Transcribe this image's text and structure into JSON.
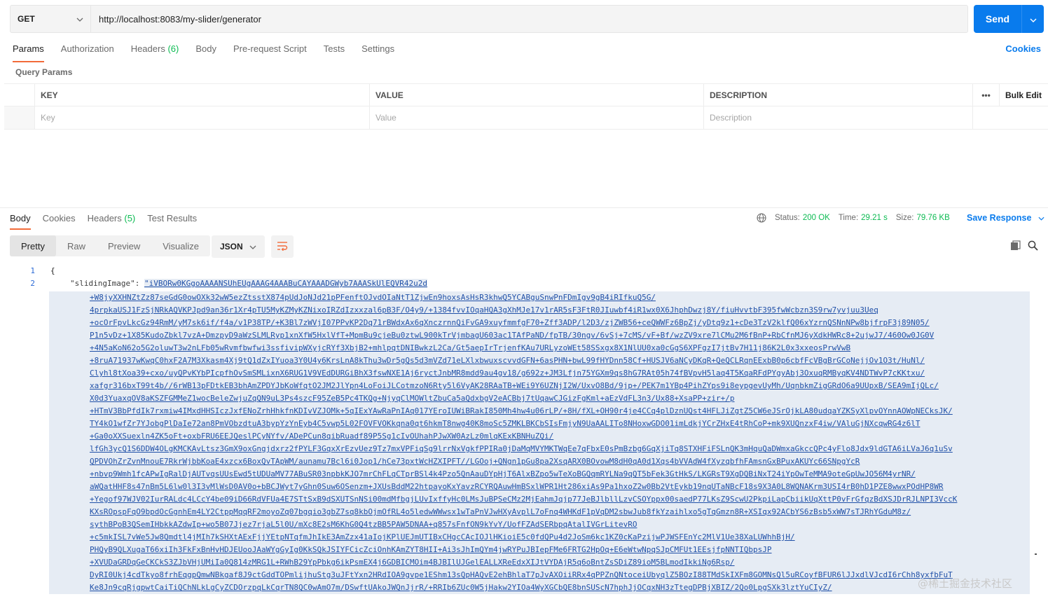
{
  "request": {
    "method": "GET",
    "url": "http://localhost:8083/my-slider/generator",
    "send_label": "Send"
  },
  "request_tabs": [
    {
      "label": "Params",
      "count": ""
    },
    {
      "label": "Authorization",
      "count": ""
    },
    {
      "label": "Headers",
      "count": "(6)"
    },
    {
      "label": "Body",
      "count": ""
    },
    {
      "label": "Pre-request Script",
      "count": ""
    },
    {
      "label": "Tests",
      "count": ""
    },
    {
      "label": "Settings",
      "count": ""
    }
  ],
  "cookies_link": "Cookies",
  "query_params": {
    "title": "Query Params",
    "headers": {
      "key": "KEY",
      "value": "VALUE",
      "description": "DESCRIPTION",
      "more": "•••",
      "bulk_edit": "Bulk Edit"
    },
    "placeholders": {
      "key": "Key",
      "value": "Value",
      "description": "Description"
    }
  },
  "response_tabs": [
    {
      "label": "Body",
      "count": ""
    },
    {
      "label": "Cookies",
      "count": ""
    },
    {
      "label": "Headers",
      "count": "(5)"
    },
    {
      "label": "Test Results",
      "count": ""
    }
  ],
  "status": {
    "status_label": "Status:",
    "status_value": "200 OK",
    "time_label": "Time:",
    "time_value": "29.21 s",
    "size_label": "Size:",
    "size_value": "79.76 KB",
    "save_response": "Save Response"
  },
  "view_modes": [
    "Pretty",
    "Raw",
    "Preview",
    "Visualize"
  ],
  "format": "JSON",
  "code": {
    "line_numbers": [
      "1",
      "2"
    ],
    "open_brace": "{",
    "key": "\"slidingImage\":",
    "value_start": "\"iVBORw0KGgoAAAANSUhEUgAAAG4AAABuCAYAAADGWyb7AAASkUlEQVR42u2d",
    "value_lines": [
      "+W8jyXXHNZtZz87seGdG0owOXk32wW5ezZtsstX874pUdJoNJd21pPFenftOJvdOIaNtT1ZjwEn9hoxsAsHsR3khwQ5YCABguSnwPnFDmIgv9gB4iRIfkuQ5G/",
      "4prpkaUSJ1FzSjNRkAQVKPJpd9an36r1Xr4pTU5MyKZMyKZNixoIRZdIzxxzal6pB3F/O4y9/+1384fvvIOqaHQA3gXhMJe17v1rAR5sF3FtR0JIuwbf4iR1wx0X6JhphDwzj8Y/fiuHvvtbF395fwWcbzn3S9rw7yvjuu3Ueq",
      "+ocOrFpvLkcGz94RmM/yM7sk6if/f4a/v1P38TP/+K3Bl7zWVjI07PPvKP2Dq71rBWdxAx6qXnczrnnQiFvGA9xuyfmmfgF70+Zff3ADP/l2D3/zjZWB56+ceQWWFz6BpZj/yDtq9z1+cDe3TzV2klfQ06xYzrnQSNnNPw8bjfrpF3j89N05/",
      "P1n5vDz+1X85KudoZbkl7vzA+DmzpyD9aWzSLMLRyp1xnXfW5HxlVfT+MpmBu9cjeBu0ztwL900kTrVjmbagU603ac1TAfPaND/fpTB/30ngv/6vSj+7cMS/vF+Bf/wzZV9xre7lCMu2M6fBnP+RbCfnMJ6yXdkHWRc8+2ujwJ7/460Ow0JG0V",
      "+4N5aKoN62o5G2oluwT3w2nLFb05wRvmfbwfwi3ssfivipWXyjcRYf3XbjB2+mhlpqtDNIBwkzL2Ca/Gt5aepIrTrjenfKAu7URLyzoWEt58SSxgx8X1NlUU0xa0cGgS6XPFgzI7jtBv7H11j86K2L0x3xxeosPrwVwB",
      "+8ruA71937wKwqC0hxF2A7M3Xkasm4Xj9tQ1dZxIYuoa3Y0U4y6KrsLnA8kThu3wDr5gQs5d3mVZd71eLXlxbwuxscvvdGFN+6asPHN+bwL99fHYDnn58Cf+HUSJV6aNCyDKqR+QeQCLRqnEExbB0p6cbfFcVBgBrGCoNejjOv1O3t/HuNl/",
      "Clyhl8tXoa39+cxo/uyQPvKYbPIcpfhOvSmSMLixnX6RUG1V9VEdDURGiBhX3fswNXE1Aj6ryctJnbMR8mdd9au4gv18/g692z+JM3Lfjn75YGXm9qs8hG7RAt05h74fBVpvH5laq4T5KqaRFdPYgyAbj3OxuqRMByqKV4NDTWvP7cKKtxu/",
      "xafgr316bxT99t4b//6rWB13pFDtkEB3bhAmZPDYJbKoWfqtO2JM2JlYpn4LoFoiJLCotmzoN6Rty5l6VyAK28RAaTB+WEi9Y6UZNjI2W/UxvO8Bd/9jp+/PEK7m1YBp4PihZYps9i8eypgevUyMh/UqnbkmZigGRdO6a9UUpxB/SEA9mIjQLc/",
      "X0d3YuaxqOV8aKSZFGMMeZ1wocBeleZwjuZqQN9uL3Ps4szcF95ZeB5Pc4TKQg+NjyqClMOWltZbuCa5aQdxbgV2eACBbj7tUqawCJGizFgKml+aEzVdFL3n3/Ux88+XsaPP+zir+/p",
      "+HTmV3BbPfdIk7rxmiw4IMxdHHSIczJxfENoZrhHhkfnKDIvVZJOMk+5qIExYAwRaPnIAq017YEroIUWiBRakI850Mh4hw4u06rLP/+8H/fXL+OH90r4je4CCq4plDznUQst4HFLJiZgtZ5CW6eJSrOjkLA80udqaYZKSyXlpvOYnnAOWpNECksJK/",
      "TY4kO1wfZr7YJobgPlDaIe72an8PmVObzdtuA3bypYzYnEyb4C5vwp5L02FOVFVOKkqna0qt6hkmT8nwg40K8moSc5ZMKLBKCbSIsFmjyN9UaAALITo8NHoxwGDO01imLdkjYCrZHxE4tRhCoP+mk9XUQnzxF4iw/VAluGjNXcqwRG4z6lT",
      "+Ga0oXXSuexln4ZK5oFt+oxbFRU6EEJQeslPCyNYfv/ADePCun8qibRuadf89P5Sg1cIvOUhahPJwXW0AzLz0mlqKExKBNHuZQi/",
      "lfGh3ycQ1S6DDW4OLgKMCKAvLtsz3GmX9oxGngjdxrz2fPYLF3GqxXrEzvUez9Tz7mxVPFiqSg9lrrNxVgkfPPIRa0jDaMqMVYMKTWqEe7qFbxE0sPmBzbg6GqXjiTq8STXHFiFSLnQK3mHquQaDWmxaGkccQPc4yFlo8Jdx9ldGTA6iLVaJ6q1uSv",
      "QPDVOhZrZvnMnouE7RkrWjbbKoaE4xzcx6BoxQvTApWM/aunamu7Bcl6i0Jop1/hCe73pxtWcHZXIPFT//LGOoj+QNgn1pGu8pa2XsqARX0BOvowM8dH0qA0d1Xqs4bVVAdW4fXyzqbfhFAmsnGxBPuxAKUYc66SNpgYcR",
      "+nbvp9Wmh1fcAPwIgRalDjAUTvqsUUsEwd5tUDUaMV77ABuSR03npbkKJO7mrChFLqCTprBSl4k4Pzo5QnAauDYpHjT6AlxBZpo5wTeXoBGQqmRYLNa9qQT5bFek3GtHkS/LKGRsT9XgDQBiNxT24iYpOwTeMMA9oteGpUwJO56M4yrNR/",
      "aWQatHHF8s47nBm5L6lw0l3I3vMlWsD0AV0o+bBCJWyt7yGhn0Suw6OSenzm+JXUsBddM22htpayoKxYavzRCYRQAuwHmBSxlWPR1Ht286xiAs9Pa1hxoZ2w0Bb2VtEykb19nqUTaNBcF18s9X3A0L8WQNAKrm3USI4rB0hD1PZE8wwxPOdHP8WR",
      "+Yegof97WJV02IurRALdc4LCcY4be09iD66RdVFUa4E7STtSxB9dSXUTSnNSi00mdMfbgjLUvIxffyHc0LMsJuBPSeCMz2MjEahmJqjp77JeBJlbllLzvCSOYppx00saedP77LKsZ9ScwU2PkpiLapCbiikUqXttP0vFrGfqzBdXSJDrRJLNPI3VccK",
      "KXsROpspFqO9bpdOcGgnhEm4LY2CtppMqqRF2moyoZq07bgqio3gbZ7sq8kbOjmOfRL4o5ledwWWwsx1wTaPnVJwHXyAvplL7oFnq4WHKdF1pVqDM2sbwJub8fkYzaihlxo5gTqGmzn8R+XSIqx92ACbYS6zBsb5xWW7sTJRhYGduM8z/",
      "sythBPoB3QSemIHbkkAZdwIp+wo5B07Jjez7rjaL5l0U/mXc8E2sM6KhG0Q4tzBB5PAW5DNAA+q857sFnfON9kYvY/UofFZAdSERbpqAtalIVGrLitevRO",
      "+c5mkISL7vWe5Jw8Qmdtl4jMIh7kSHXtAExFjjYEtpNTqfmJhIkE3AmZzx41aIojKPlUEJmUTIBxCHgcCAcIOJlHKioiE5c0fdQPu4d2JoSm6kc1KZ0cKaPzijwPJWSFEnYc2MlV1Ue38XaLUWhhBjH/",
      "PHQyB9QLXugaT66xiIh3FkFxBnHvHDJEUooJAaWYgGyIg0KkSQkJSIYFCicZciOnhKAmZYT8HII+Ai3sJhImQYm4jwRYPuJBIepFMe6FRTG2HpOq+E6eWtwNpqSJpCMFUt1EEsjfpNNTIQbpsJP",
      "+XVUDaGRDqGeCKCkS3ZJbVHjUMiIa0Q814zMRG1L+RWhB29YpPbkg6ikPsmEX4j6GDBICMOim4BJBIlUJGelEALLXReEdxXIJtVYDAjR5q6oBntZsSDiZ89ioM5BLmodIkkiNg6Rsp/",
      "DyRI0Ukj4cdTkyo8frhEqgpQmwNBkgaf8J9ctGddTOPmlijhuStg3uJFtYxn2HRdIOA9gvpe1EShm13sQpHAQvE2ehBhlaT7pJvAXOiiRRx4qPPZnQNtoceiUbyqlZ5BOzI88TMdSkIXFm8GOMNsQl5uRCoyfBFUR6lJJxdlVJcdI6rChh8yxfbFuT",
      "Ke8Jn9cqRjgpwtCaiTiQChNLkLgCyZCDOrzpqLkCqrTN8QC0wAmO7m/DSwftUAkoJWQnJjrR/+RRIb6ZUc0W5jHakw2YIOa4WyXGCbQE8bnSUScN7hphJjOCqxNH3zTtegDPBjXBIZ/2Qo0LpgSXk3lztYuCIyZ/"
    ]
  },
  "watermark": "@稀土掘金技术社区"
}
